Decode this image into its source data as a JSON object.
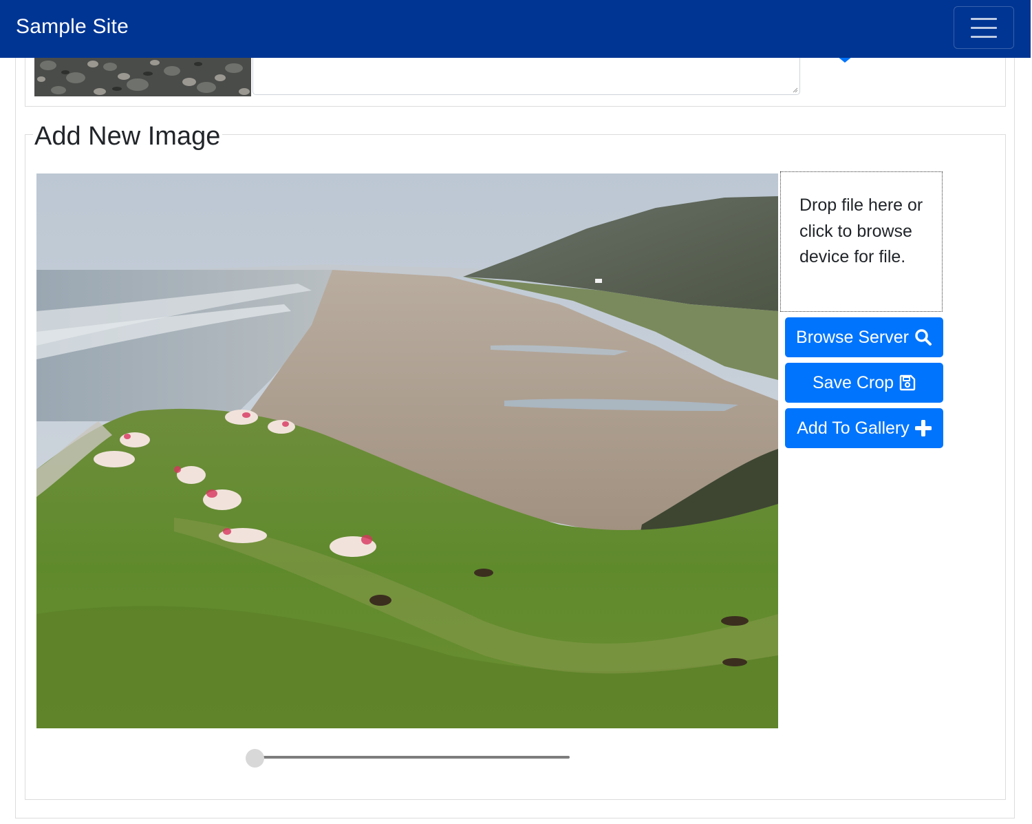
{
  "navbar": {
    "brand": "Sample Site",
    "toggler_icon": "hamburger-menu-icon",
    "background_color": "#003593"
  },
  "previous_item": {
    "thumbnail": "rocky-beach-photo",
    "caption_value": ""
  },
  "add_image": {
    "legend": "Add New Image",
    "photo": "coastal-cliff-with-sheep-photo",
    "dropzone_text": "Drop file here or click to browse device for file.",
    "buttons": {
      "browse_server": {
        "label": "Browse Server",
        "icon": "search-icon"
      },
      "save_crop": {
        "label": "Save Crop",
        "icon": "floppy-disk-icon"
      },
      "add_to_gallery": {
        "label": "Add To Gallery",
        "icon": "plus-icon"
      }
    },
    "button_color": "#0074fc",
    "zoom_slider": {
      "value": 0
    }
  }
}
